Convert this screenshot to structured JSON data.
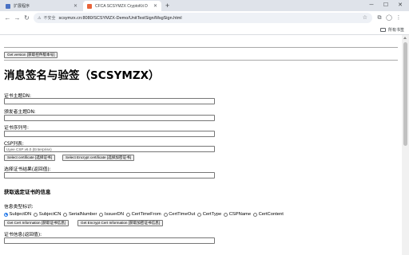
{
  "browser": {
    "tabs": [
      {
        "title": "扩展程序",
        "active": false
      },
      {
        "title": "CFCA SCSYMZX CryptoKit D",
        "active": true
      }
    ],
    "security_label": "不安全",
    "url": "scsymzx.cn:8080/SCSYMZX-Demo/UnitTestSign/MsgSign.html",
    "bookmarks_all": "所有书签"
  },
  "page": {
    "get_version_button": "Get version [获取控件版本号]",
    "title": "消息签名与验签（SCSYMZX）",
    "cert_subject_dn_label": "证书主题DN:",
    "issuer_subject_dn_label": "颁发者主题DN:",
    "cert_serial_label": "证书序列号:",
    "csp_list_label": "CSP列表:",
    "csp_selected": "Uyee CSP v6.0 (Enterprise)",
    "select_cert_button": "Select certificate [选择证书]",
    "select_encrypt_cert_button": "Select Encrypt certificate [选择加密证书]",
    "select_result_label": "选择证书结果(返回值):",
    "cert_info_heading": "获取选定证书的信息",
    "info_type_label": "信息类型标识:",
    "info_types": [
      {
        "label": "SubjectDN",
        "checked": true
      },
      {
        "label": "SubjectCN",
        "checked": false
      },
      {
        "label": "SerialNumber",
        "checked": false
      },
      {
        "label": "IssuerDN",
        "checked": false
      },
      {
        "label": "CertTimeFrom",
        "checked": false
      },
      {
        "label": "CertTimeOut",
        "checked": false
      },
      {
        "label": "CertType",
        "checked": false
      },
      {
        "label": "CSPName",
        "checked": false
      },
      {
        "label": "CertContent",
        "checked": false
      }
    ],
    "get_cert_info_button": "Get Cert Information [获取证书信息]",
    "get_encrypt_cert_info_button": "Get Encrypt Cert Information [获取加密证书信息]",
    "cert_info_result_label": "证书信息(返回值):"
  }
}
